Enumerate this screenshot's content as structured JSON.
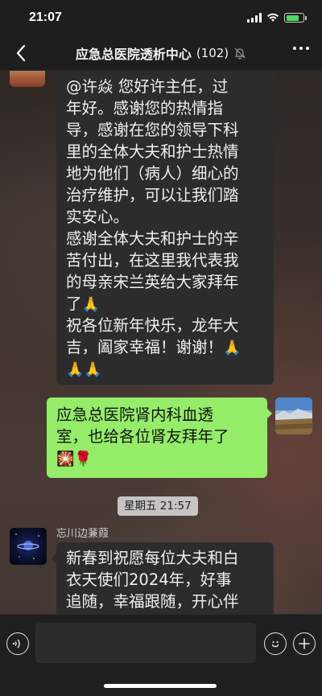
{
  "status_bar": {
    "time": "21:07",
    "battery_level": 0.75,
    "battery_color": "#4cd964"
  },
  "nav": {
    "title": "应急总医院透析中心",
    "member_count": "(102)",
    "back_icon": "chevron-left-icon",
    "mute_icon": "bell-slash-icon",
    "more_icon": "more-dots-icon"
  },
  "messages": [
    {
      "side": "left",
      "lines": [
        "@许焱 您好许主任，过",
        "年好。感谢您的热情指",
        "导，感谢在您的领导下科",
        "里的全体大夫和护士热情",
        "地为他们（病人）细心的",
        "治疗维护，可以让我们踏",
        "实安心。",
        "感谢全体大夫和护士的辛",
        "苦付出，在这里我代表我",
        "的母亲宋兰英给大家拜年",
        "了",
        "祝各位新年快乐，龙年大",
        "吉，阖家幸福！谢谢！"
      ],
      "emojis": [
        "🙏",
        "🙏",
        "🙏",
        "🙏"
      ]
    },
    {
      "side": "right",
      "lines": [
        "应急总医院肾内科血透",
        "室，也给各位肾友拜年了"
      ],
      "emojis": [
        "🎇",
        "🌹"
      ],
      "bubble_color": "#95ec69"
    },
    {
      "side": "left",
      "sender": "忘川边蒹葭",
      "lines": [
        "新春到祝愿每位大夫和白",
        "衣天使们2024年，好事",
        "追随，幸福跟随，开心伴"
      ]
    }
  ],
  "timestamp": "星期五 21:57",
  "input_bar": {
    "voice_icon": "voice-icon",
    "emoji_icon": "smile-icon",
    "plus_icon": "plus-icon"
  }
}
